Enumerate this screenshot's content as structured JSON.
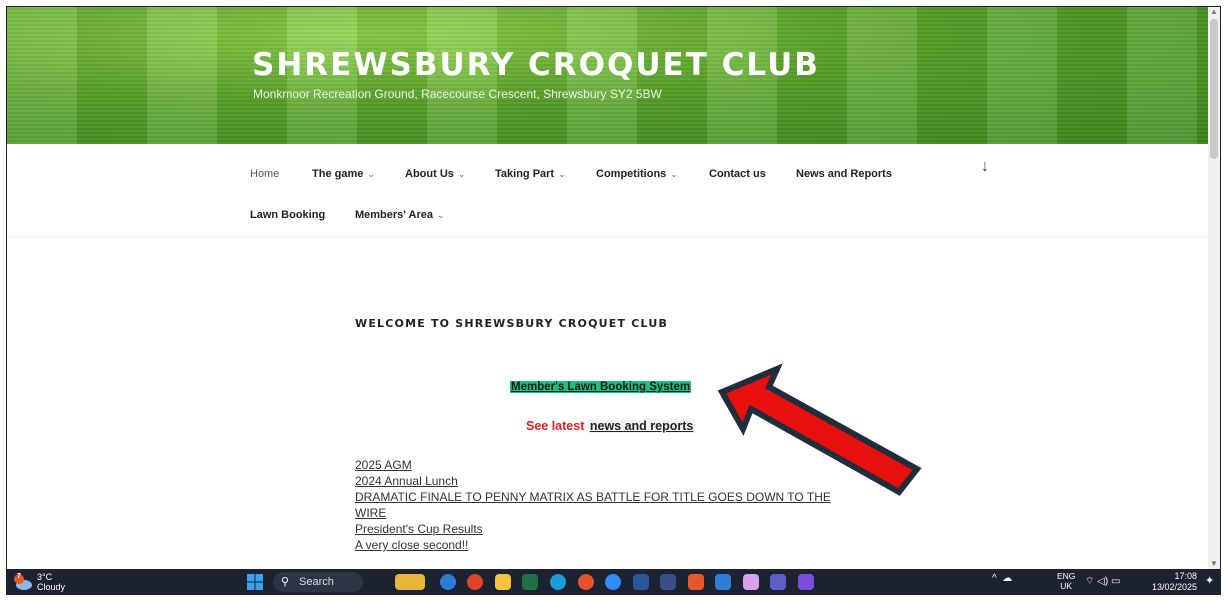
{
  "site": {
    "title": "SHREWSBURY CROQUET CLUB",
    "description": "Monkmoor Recreation Ground, Racecourse Crescent, Shrewsbury SY2 5BW"
  },
  "nav": {
    "items": [
      {
        "label": "Home",
        "chevron": false
      },
      {
        "label": "The game",
        "chevron": true
      },
      {
        "label": "About Us",
        "chevron": true
      },
      {
        "label": "Taking Part",
        "chevron": true
      },
      {
        "label": "Competitions",
        "chevron": true
      },
      {
        "label": "Contact us",
        "chevron": false
      },
      {
        "label": "News and Reports",
        "chevron": false
      },
      {
        "label": "Lawn Booking",
        "chevron": false
      },
      {
        "label": "Members' Area",
        "chevron": true
      }
    ],
    "chevron_glyph": "⌄",
    "scroll_icon": "down-arrow-icon"
  },
  "content": {
    "welcome": "WELCOME TO SHREWSBURY CROQUET CLUB",
    "booking_link": "Member's Lawn Booking System",
    "news_prefix": "See latest",
    "news_link": "news and reports",
    "news_items": [
      "2025 AGM",
      "2024 Annual Lunch",
      "DRAMATIC FINALE TO PENNY MATRIX AS  BATTLE FOR TITLE GOES DOWN TO THE",
      "WIRE",
      "President's Cup Results",
      "A very close second!!"
    ]
  },
  "annotation": {
    "arrow_color": "#e8100c",
    "arrow_outline": "#1f2d3d"
  },
  "taskbar": {
    "weather_temp": "3°C",
    "weather_desc": "Cloudy",
    "weather_badge": "7",
    "search_placeholder": "Search",
    "lang_top": "ENG",
    "lang_bottom": "UK",
    "time": "17:08",
    "date": "13/02/2025"
  },
  "colors": {
    "booking_highlight": "#19c37d",
    "news_prefix": "#d22222",
    "taskbar": "#1c2230"
  }
}
